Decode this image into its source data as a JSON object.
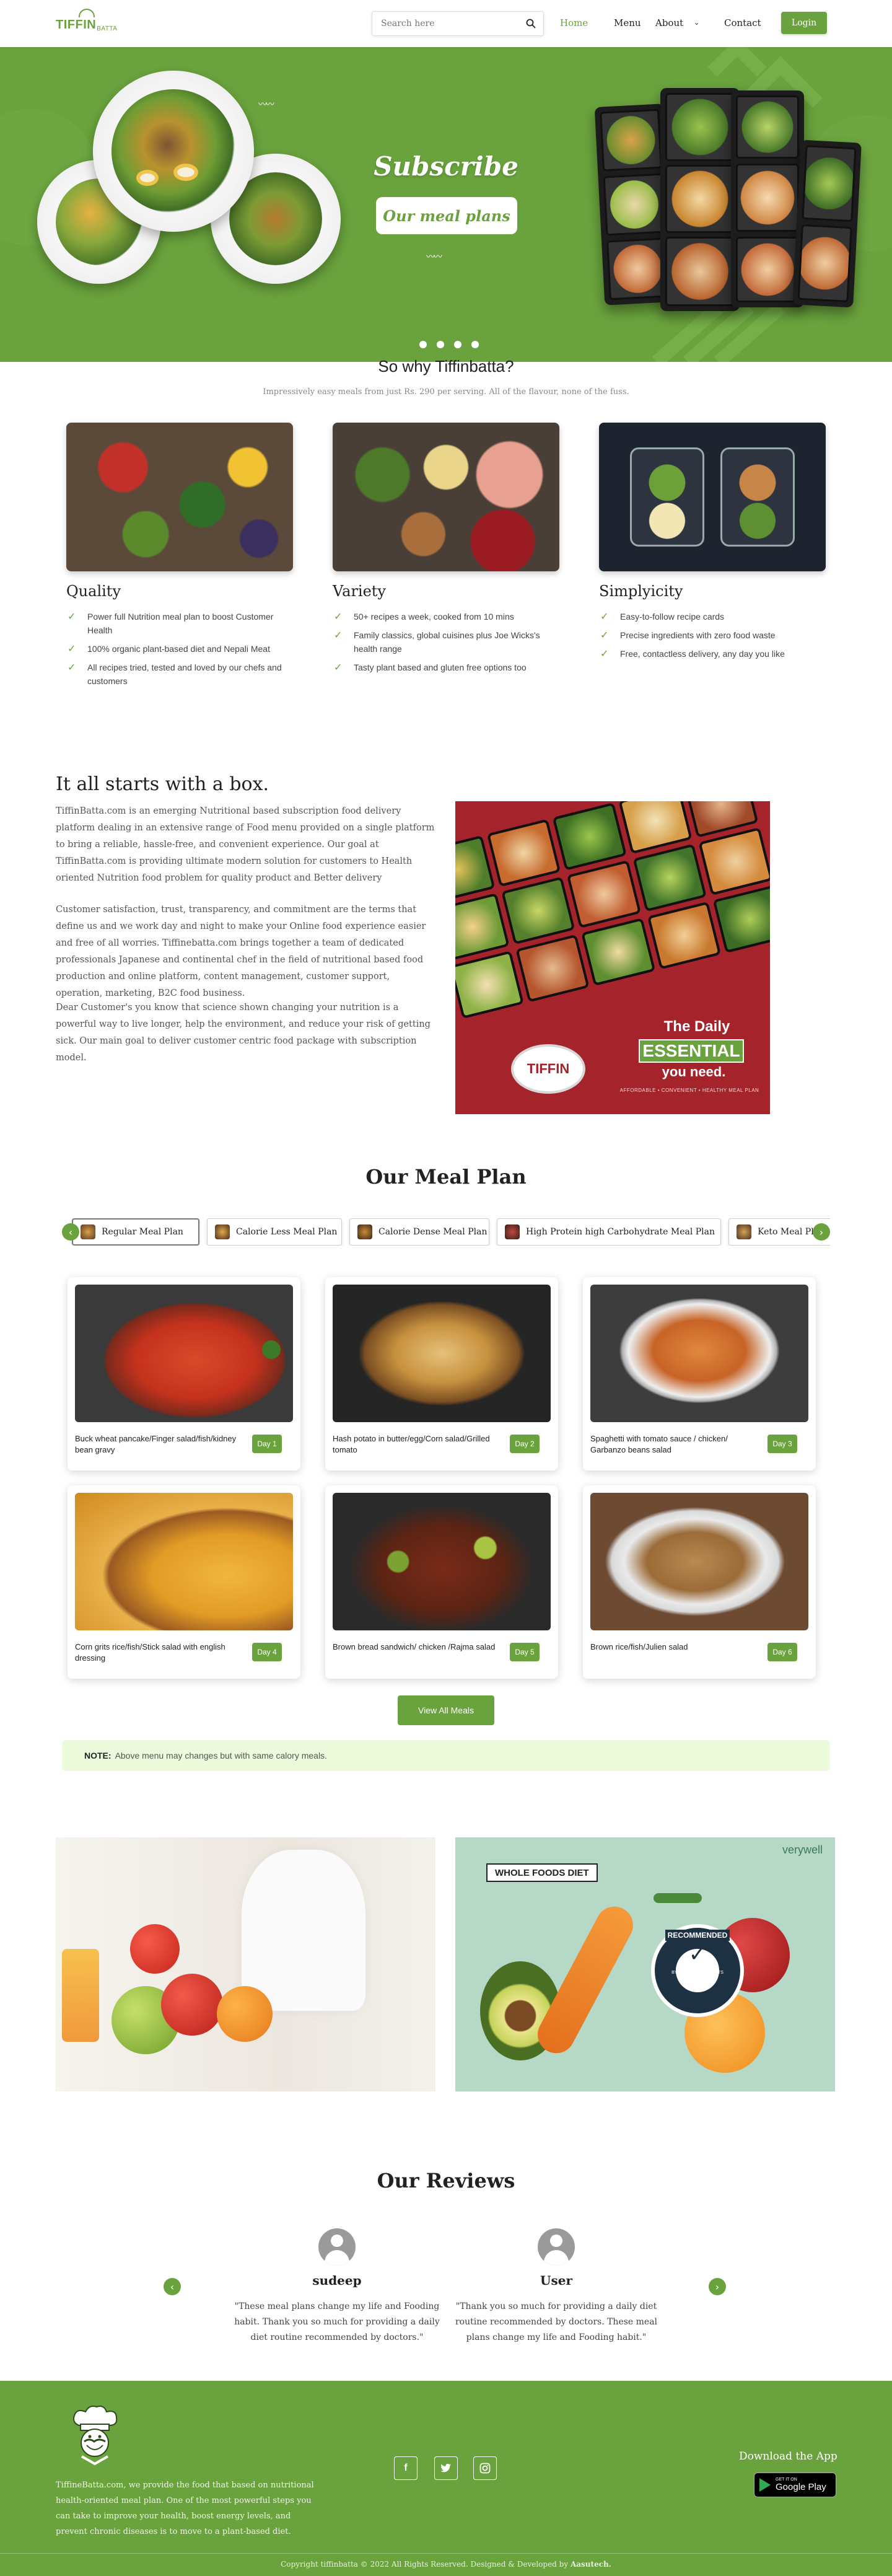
{
  "header": {
    "logo_text": "TIFFIN",
    "logo_sub": "BATTA",
    "search_placeholder": "Search here",
    "nav": [
      "Home",
      "Menu",
      "About",
      "Contact"
    ],
    "login_label": "Login"
  },
  "hero": {
    "title": "Subscribe",
    "button_label": "Our meal plans",
    "slide_count": 4
  },
  "why": {
    "title": "So why Tiffinbatta?",
    "subtitle": "Impressively easy meals from just Rs. 290 per serving. All of the flavour, none of the fuss.",
    "columns": [
      {
        "title": "Quality",
        "items": [
          "Power full Nutrition meal plan to boost Customer Health",
          "100% organic plant-based diet and Nepali Meat",
          "All recipes tried, tested and loved by our chefs and customers"
        ]
      },
      {
        "title": "Variety",
        "items": [
          "50+ recipes a week, cooked from 10 mins",
          "Family classics, global cuisines plus Joe Wicks's health range",
          "Tasty plant based and gluten free options too"
        ]
      },
      {
        "title": "Simplyicity",
        "items": [
          "Easy-to-follow recipe cards",
          "Precise ingredients with zero food waste",
          "Free, contactless delivery, any day you like"
        ]
      }
    ]
  },
  "box": {
    "title": "It all starts with a box.",
    "paragraphs": [
      "TiffinBatta.com is an emerging Nutritional based subscription food delivery platform dealing in an extensive range of Food menu provided on a single platform to bring a reliable, hassle-free, and convenient experience. Our goal at TiffinBatta.com is providing ultimate modern solution for customers to Health oriented Nutrition food problem for quality product and Better delivery",
      "Customer satisfaction, trust, transparency, and commitment are the terms that define us and we work day and night to make your Online food experience easier and free of all worries. Tiffinebatta.com brings together a team of dedicated professionals Japanese and continental chef in the field of nutritional based food production and online platform, content management, customer support, operation, marketing, B2C food business.",
      "Dear Customer's you know that science shown changing your nutrition is a powerful way to live longer, help the environment, and reduce your risk of getting sick. Our main goal to deliver customer centric food package with subscription model."
    ],
    "image_caption_1": "The Daily",
    "image_caption_2": "ESSENTIAL",
    "image_caption_3": "you need.",
    "image_tagline": "AFFORDABLE • CONVENIENT • HEALTHY MEAL PLAN"
  },
  "meal_plan": {
    "title": "Our Meal Plan",
    "tabs": [
      "Regular Meal Plan",
      "Calorie Less Meal Plan",
      "Calorie Dense Meal Plan",
      "High Protein high Carbohydrate Meal Plan",
      "Keto Meal Plan"
    ],
    "meals": [
      {
        "name": "Buck wheat pancake/Finger salad/fish/kidney bean gravy",
        "day": "Day 1"
      },
      {
        "name": "Hash potato in butter/egg/Corn salad/Grilled tomato",
        "day": "Day 2"
      },
      {
        "name": "Spaghetti with tomato sauce / chicken/ Garbanzo beans salad",
        "day": "Day 3"
      },
      {
        "name": "Corn grits rice/fish/Stick salad with english dressing",
        "day": "Day 4"
      },
      {
        "name": "Brown bread sandwich/ chicken /Rajma salad",
        "day": "Day 5"
      },
      {
        "name": "Brown rice/fish/Julien salad",
        "day": "Day 6"
      }
    ],
    "view_all_label": "View All Meals",
    "note_label": "NOTE:",
    "note_text": "Above menu may changes but with same calory meals."
  },
  "banners": {
    "right_tag": "WHOLE FOODS DIET",
    "right_brand": "verywell",
    "seal_top": "RECOMMENDED",
    "seal_bottom": "BY NUTRITION EXPERTS"
  },
  "reviews": {
    "title": "Our Reviews",
    "items": [
      {
        "name": "sudeep",
        "text": "\"These meal plans change my life and Fooding habit. Thank you so much for providing a daily diet routine recommended by doctors.\""
      },
      {
        "name": "User",
        "text": "\"Thank you so much for providing a daily diet routine recommended by doctors. These meal plans change my life and Fooding habit.\""
      }
    ]
  },
  "footer": {
    "about_text": "TiffineBatta.com, we provide the food that based on nutritional health-oriented meal plan. One of the most powerful steps you can take to improve your health, boost energy levels, and prevent chronic diseases is to move to a plant-based diet.",
    "download_title": "Download the App",
    "gplay_small": "GET IT ON",
    "gplay_big": "Google Play",
    "social": [
      "facebook-icon",
      "twitter-icon",
      "instagram-icon"
    ],
    "copyright": "Copyright tiffinbatta © 2022 All Rights Reserved. Designed & Developed by",
    "developer": "Aasutech."
  },
  "colors": {
    "brand": "#6aa33d",
    "note_bg": "#eefadc",
    "box_red": "#a5232b"
  }
}
